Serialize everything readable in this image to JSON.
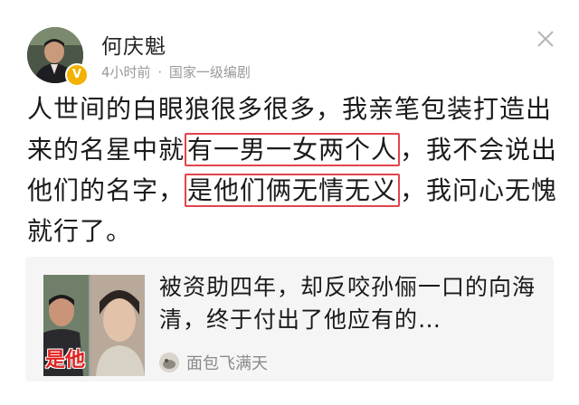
{
  "author": {
    "name": "何庆魁",
    "time": "4小时前",
    "separator": "·",
    "title": "国家一级编剧",
    "verified_mark": "V"
  },
  "post": {
    "segments": [
      {
        "text": "人世间的白眼狼很多很多，我亲笔包装打造出来的名星中就",
        "highlight": false
      },
      {
        "text": "有一男一女两个人",
        "highlight": true
      },
      {
        "text": "，我不会说出他们的名字，",
        "highlight": false
      },
      {
        "text": "是他们俩无情无义",
        "highlight": true
      },
      {
        "text": "，",
        "highlight": false
      },
      {
        "text": "我问心无愧就行了。",
        "highlight": false
      }
    ]
  },
  "linked_card": {
    "title": "被资助四年，却反咬孙俪一口的向海清，终于付出了他应有的…",
    "thumbnail_caption": "是他",
    "source_name": "面包飞满天"
  },
  "colors": {
    "highlight_border": "#e2434d",
    "verified_badge": "#f2b200",
    "card_bg": "#f5f5f5"
  },
  "icons": [
    "close-icon",
    "verified-badge-icon",
    "source-avatar-icon"
  ]
}
